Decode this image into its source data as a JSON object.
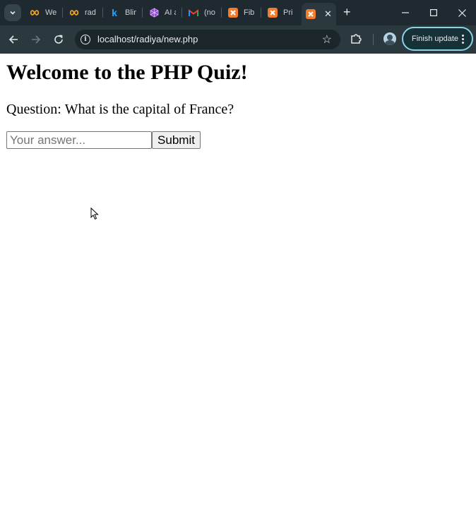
{
  "browser": {
    "tabs": [
      {
        "title": "We",
        "icon": "infinity-icon",
        "active": false
      },
      {
        "title": "rad",
        "icon": "infinity-icon",
        "active": false
      },
      {
        "title": "Blir",
        "icon": "k-logo-icon",
        "active": false
      },
      {
        "title": "AI a",
        "icon": "cube-logo-icon",
        "active": false
      },
      {
        "title": "(no",
        "icon": "gmail-icon",
        "active": false
      },
      {
        "title": "Fib",
        "icon": "xampp-icon",
        "active": false
      },
      {
        "title": "Pri",
        "icon": "xampp-icon",
        "active": false
      },
      {
        "title": "",
        "icon": "xampp-icon",
        "active": true
      }
    ],
    "url": "localhost/radiya/new.php",
    "update_button_label": "Finish update",
    "colors": {
      "tabbar_bg": "#1f2a30",
      "toolbar_bg": "#2b393f",
      "update_border": "#8ad3e6",
      "xampp_orange": "#f57c2b"
    }
  },
  "page": {
    "heading": "Welcome to the PHP Quiz!",
    "question_label": "Question:",
    "question_text": "What is the capital of France?",
    "answer_value": "",
    "answer_placeholder": "Your answer...",
    "submit_label": "Submit"
  }
}
